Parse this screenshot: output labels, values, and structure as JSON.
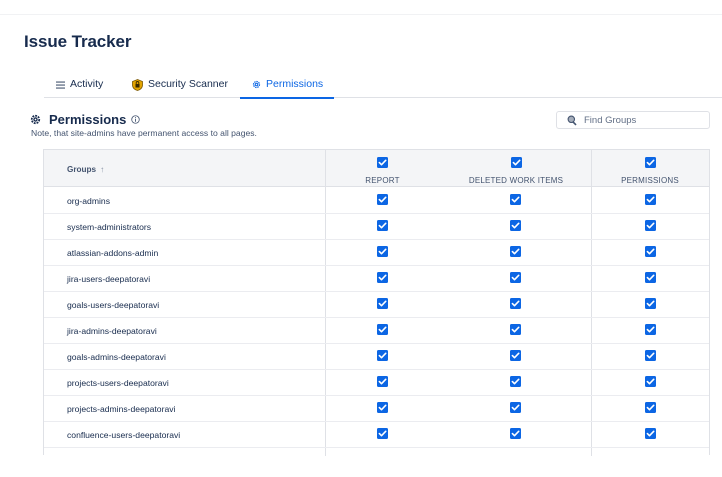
{
  "app": {
    "title": "Issue Tracker"
  },
  "tabs": [
    {
      "label": "Activity",
      "icon": "list-icon",
      "active": false
    },
    {
      "label": "Security Scanner",
      "icon": "shield-lock-icon",
      "active": false
    },
    {
      "label": "Permissions",
      "icon": "gear-icon",
      "active": true
    }
  ],
  "section": {
    "title": "Permissions",
    "icon": "gear-icon",
    "info_icon": "info-icon",
    "note": "Note, that site-admins have permanent access to all pages."
  },
  "search": {
    "placeholder": "Find Groups",
    "value": ""
  },
  "table": {
    "group_header": "Groups",
    "sort_indicator": "↑",
    "columns": [
      {
        "label": "REPORT",
        "all_checked": true
      },
      {
        "label": "DELETED WORK ITEMS",
        "all_checked": true
      },
      {
        "label": "PERMISSIONS",
        "all_checked": true
      }
    ],
    "rows": [
      {
        "group": "org-admins",
        "report": true,
        "deleted_work_items": true,
        "permissions": true
      },
      {
        "group": "system-administrators",
        "report": true,
        "deleted_work_items": true,
        "permissions": true
      },
      {
        "group": "atlassian-addons-admin",
        "report": true,
        "deleted_work_items": true,
        "permissions": true
      },
      {
        "group": "jira-users-deepatoravi",
        "report": true,
        "deleted_work_items": true,
        "permissions": true
      },
      {
        "group": "goals-users-deepatoravi",
        "report": true,
        "deleted_work_items": true,
        "permissions": true
      },
      {
        "group": "jira-admins-deepatoravi",
        "report": true,
        "deleted_work_items": true,
        "permissions": true
      },
      {
        "group": "goals-admins-deepatoravi",
        "report": true,
        "deleted_work_items": true,
        "permissions": true
      },
      {
        "group": "projects-users-deepatoravi",
        "report": true,
        "deleted_work_items": true,
        "permissions": true
      },
      {
        "group": "projects-admins-deepatoravi",
        "report": true,
        "deleted_work_items": true,
        "permissions": true
      },
      {
        "group": "confluence-users-deepatoravi",
        "report": true,
        "deleted_work_items": true,
        "permissions": true
      }
    ]
  },
  "colors": {
    "accent": "#0c66e4",
    "checkbox": "#0c66e4",
    "text": "#172b4d",
    "header_bg": "#f4f5f7"
  }
}
